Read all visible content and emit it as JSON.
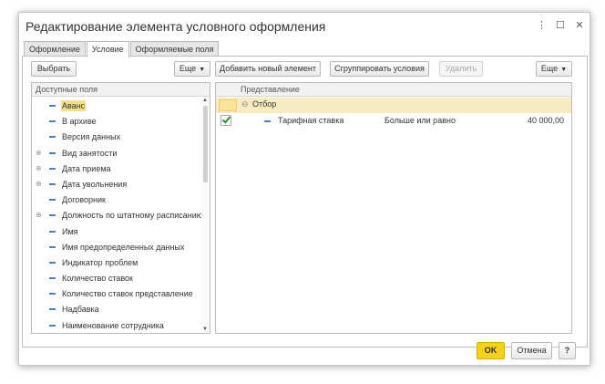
{
  "window": {
    "title": "Редактирование элемента условного оформления",
    "menu_icon": "more-vertical-icon",
    "maximize_icon": "maximize-icon",
    "close_icon": "close-icon"
  },
  "tabs": [
    {
      "label": "Оформление"
    },
    {
      "label": "Условие",
      "active": true
    },
    {
      "label": "Оформляемые поля"
    }
  ],
  "left_toolbar": {
    "select_label": "Выбрать",
    "more_label": "Еще"
  },
  "right_toolbar": {
    "add_label": "Добавить новый элемент",
    "group_label": "Сгруппировать условия",
    "delete_label": "Удалить",
    "more_label": "Еще"
  },
  "fields_panel": {
    "header": "Доступные поля",
    "items": [
      {
        "label": "Аванс",
        "expandable": false,
        "selected": true
      },
      {
        "label": "В архиве",
        "expandable": false
      },
      {
        "label": "Версия данных",
        "expandable": false
      },
      {
        "label": "Вид занятости",
        "expandable": true
      },
      {
        "label": "Дата приема",
        "expandable": true
      },
      {
        "label": "Дата увольнения",
        "expandable": true
      },
      {
        "label": "Договорник",
        "expandable": false
      },
      {
        "label": "Должность по штатному расписанию",
        "expandable": true
      },
      {
        "label": "Имя",
        "expandable": false
      },
      {
        "label": "Имя предопределенных данных",
        "expandable": false
      },
      {
        "label": "Индикатор проблем",
        "expandable": false
      },
      {
        "label": "Количество ставок",
        "expandable": false
      },
      {
        "label": "Количество ставок представление",
        "expandable": false
      },
      {
        "label": "Надбавка",
        "expandable": false
      },
      {
        "label": "Наименование сотрудника",
        "expandable": false
      }
    ]
  },
  "conditions_panel": {
    "header": "Представление",
    "group": {
      "label": "Отбор"
    },
    "items": [
      {
        "checked": true,
        "field": "Тарифная ставка",
        "condition": "Больше или равно",
        "value": "40 000,00"
      }
    ]
  },
  "footer": {
    "ok_label": "OK",
    "cancel_label": "Отмена",
    "help_label": "?"
  },
  "colors": {
    "accent_ok": "#f5d21a",
    "selection": "#f5e08a",
    "field_dash": "#4a7fc1"
  }
}
